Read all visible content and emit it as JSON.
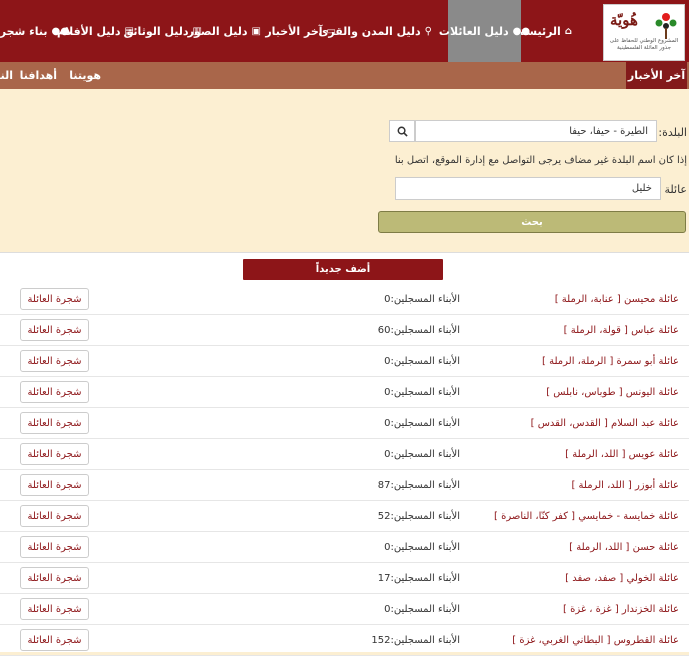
{
  "logo": {
    "title": "هُويّة",
    "subtitle": "المشروع الوطني للحفاظ على جذور العائلة الفلسطينية"
  },
  "nav": [
    {
      "label": "الرئيسة",
      "icon": "home-icon",
      "glyph": "⌂"
    },
    {
      "label": "دليل العائلات",
      "icon": "users-icon",
      "glyph": "●●",
      "active": true
    },
    {
      "label": "دليل المدن والقرى",
      "icon": "map-marker-icon",
      "glyph": "⚲"
    },
    {
      "label": "آخر الأخبار",
      "icon": "newspaper-icon",
      "glyph": "▭"
    },
    {
      "label": "دليل الصور",
      "icon": "picture-icon",
      "glyph": "▣"
    },
    {
      "label": "دليل الوثائق",
      "icon": "book-icon",
      "glyph": "▥"
    },
    {
      "label": "دليل الأفلام",
      "icon": "film-icon",
      "glyph": "▤"
    },
    {
      "label": "بناء شجرة العائلة",
      "icon": "group-icon",
      "glyph": "●●"
    }
  ],
  "subnav": {
    "active": "آخر الأخبار",
    "links": [
      "هويتنا",
      "أهدافنا",
      "النـ"
    ]
  },
  "search": {
    "town_label": "البلدة:",
    "town_value": "الطيرة - حيفا، حيفا",
    "note": "إذا كان اسم البلدة غير مضاف يرجى التواصل مع إدارة الموقع، اتصل بنا",
    "family_label": "عائلة",
    "family_value": "خليل",
    "submit_label": "بحث"
  },
  "add_new_label": "أضف جديداً",
  "count_label": "الأبناء المسجلين:",
  "tree_label": "شجرة العائلة",
  "families": [
    {
      "name": "عائلة محيسن [ عنابة، الرملة ]",
      "count": 0
    },
    {
      "name": "عائلة عباس [ قولة، الرملة ]",
      "count": 60
    },
    {
      "name": "عائلة أبو سمرة [ الرملة، الرملة ]",
      "count": 0
    },
    {
      "name": "عائلة اليونس [ طوباس، نابلس ]",
      "count": 0
    },
    {
      "name": "عائلة عبد السلام [ القدس، القدس ]",
      "count": 0
    },
    {
      "name": "عائلة عويس [ اللد، الرملة ]",
      "count": 0
    },
    {
      "name": "عائلة أبوزر [ اللد، الرملة ]",
      "count": 87
    },
    {
      "name": "عائلة خمايسة - خمايسي [ كفر كنّا، الناصرة ]",
      "count": 52
    },
    {
      "name": "عائلة حسن [ اللد، الرملة ]",
      "count": 0
    },
    {
      "name": "عائلة الخولي [ صفد، صفد ]",
      "count": 17
    },
    {
      "name": "عائلة الخزندار [ غزة ، غزة ]",
      "count": 0
    },
    {
      "name": "عائلة القطروس [ البطاني الغربي، غزة ]",
      "count": 152
    }
  ],
  "colors": {
    "header": "#8d1518",
    "subbar": "#a9664a",
    "background": "#fcefd2",
    "submit": "#bcba77",
    "active_nav": "#8a8a8a"
  }
}
